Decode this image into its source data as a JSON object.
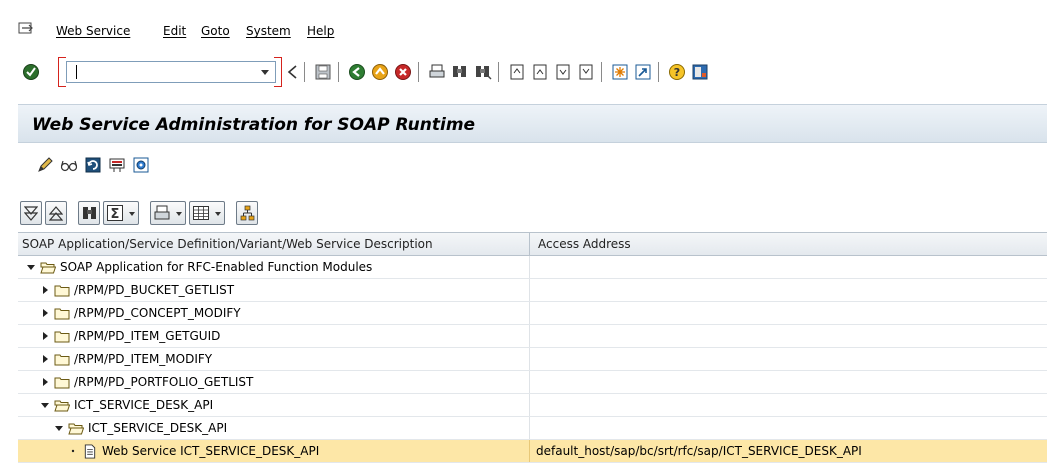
{
  "menu": {
    "items": [
      "Web Service",
      "Edit",
      "Goto",
      "System",
      "Help"
    ]
  },
  "toolbar": {
    "command_value": ""
  },
  "title": "Web Service Administration for SOAP Runtime",
  "table": {
    "headers": [
      "SOAP Application/Service Definition/Variant/Web Service Description",
      "Access Address"
    ],
    "rows": [
      {
        "label": "SOAP Application for RFC-Enabled Function Modules",
        "address": "",
        "level": 0,
        "toggle": "open",
        "icon": "folder-open-icon"
      },
      {
        "label": "/RPM/PD_BUCKET_GETLIST",
        "address": "",
        "level": 1,
        "toggle": "closed",
        "icon": "folder-icon"
      },
      {
        "label": "/RPM/PD_CONCEPT_MODIFY",
        "address": "",
        "level": 1,
        "toggle": "closed",
        "icon": "folder-icon"
      },
      {
        "label": "/RPM/PD_ITEM_GETGUID",
        "address": "",
        "level": 1,
        "toggle": "closed",
        "icon": "folder-icon"
      },
      {
        "label": "/RPM/PD_ITEM_MODIFY",
        "address": "",
        "level": 1,
        "toggle": "closed",
        "icon": "folder-icon"
      },
      {
        "label": "/RPM/PD_PORTFOLIO_GETLIST",
        "address": "",
        "level": 1,
        "toggle": "closed",
        "icon": "folder-icon"
      },
      {
        "label": "ICT_SERVICE_DESK_API",
        "address": "",
        "level": 1,
        "toggle": "open",
        "icon": "folder-open-icon"
      },
      {
        "label": "ICT_SERVICE_DESK_API",
        "address": "",
        "level": 2,
        "toggle": "open",
        "icon": "folder-open-icon"
      },
      {
        "label": "Web Service ICT_SERVICE_DESK_API",
        "address": "default_host/sap/bc/srt/rfc/sap/ICT_SERVICE_DESK_API",
        "level": 3,
        "toggle": "leaf",
        "icon": "document-icon",
        "selected": true
      }
    ]
  },
  "colors": {
    "selected_row": "#fde7a7",
    "title_bg": "#e3eaf1"
  }
}
